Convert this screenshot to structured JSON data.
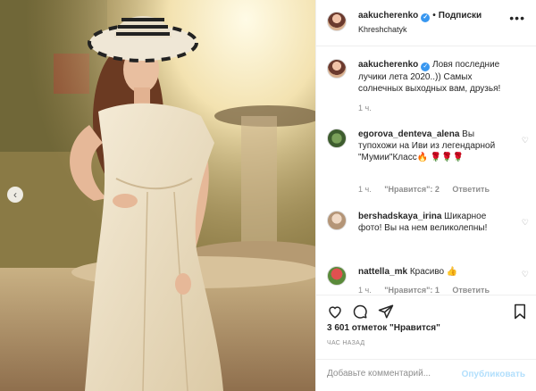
{
  "post": {
    "username": "aakucherenko",
    "follow_label": "Подписки",
    "location": "Khreshchatyk",
    "more_icon": "more-icon",
    "verified_icon": "verified-icon"
  },
  "caption": {
    "username": "aakucherenko",
    "text": "Ловя последние лучики лета 2020..)) Самых солнечных выходных вам, друзья!",
    "time": "1 ч."
  },
  "comments": [
    {
      "username": "egorova_denteva_alena",
      "text": "Вы тупохожи на Иви из легендарной \"Мумии\"Класс🔥 🌹🌹🌹",
      "time": "1 ч.",
      "likes": "\"Нравится\": 2",
      "reply": "Ответить"
    },
    {
      "username": "bershadskaya_irina",
      "text": "Шикарное фото! Вы на нем великолепны!",
      "time": "",
      "likes": "",
      "reply": ""
    },
    {
      "username": "nattella_mk",
      "text": "Красиво 👍",
      "time": "1 ч.",
      "likes": "\"Нравится\": 1",
      "reply": "Ответить"
    }
  ],
  "actions": {
    "like_icon": "heart-icon",
    "comment_icon": "comment-icon",
    "share_icon": "share-icon",
    "save_icon": "bookmark-icon"
  },
  "likes_text": "3 601 отметок \"Нравится\"",
  "timestamp": "ЧАС НАЗАД",
  "add_comment": {
    "placeholder": "Добавьте комментарий...",
    "publish_label": "Опубликовать"
  },
  "colors": {
    "accent": "#3897f0",
    "publish_disabled": "#b2dffc",
    "muted": "#8e8e8e",
    "text": "#262626"
  }
}
